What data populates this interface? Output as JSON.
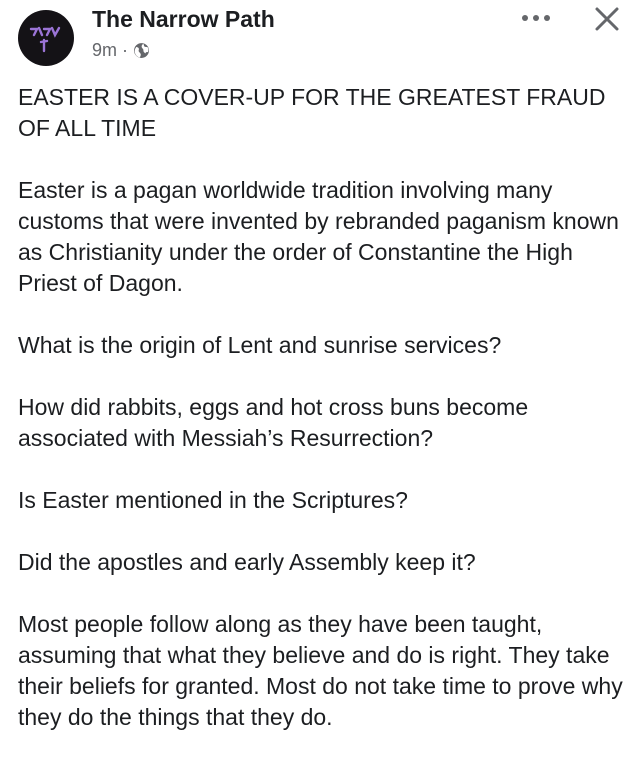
{
  "post": {
    "page_name": "The Narrow Path",
    "time_ago": "9m",
    "separator": "·",
    "audience_icon": "globe-icon",
    "avatar_icon": "page-avatar-logo",
    "more_icon": "more-horizontal-icon",
    "close_icon": "close-icon",
    "paragraphs": [
      "EASTER IS A COVER-UP FOR THE GREATEST FRAUD OF ALL TIME",
      "Easter is a pagan worldwide tradition involving many customs that were invented by rebranded paganism known as Christianity under the order of Constantine the High Priest of Dagon.",
      "What is the origin of Lent and sunrise services?",
      "How did rabbits, eggs and hot cross buns become associated with Messiah’s Resurrection?",
      "Is Easter mentioned in the Scriptures?",
      "Did the apostles and early Assembly keep it?",
      "Most people follow along as they have been taught, assuming that what they believe and do is right. They take their beliefs for granted. Most do not take time to prove why they do the things that they do."
    ]
  },
  "colors": {
    "text": "#1c1e21",
    "secondary_text": "#65676b",
    "avatar_background": "#141216",
    "avatar_glyph": "#9b74d6",
    "icon": "#65676b",
    "background": "#ffffff"
  }
}
